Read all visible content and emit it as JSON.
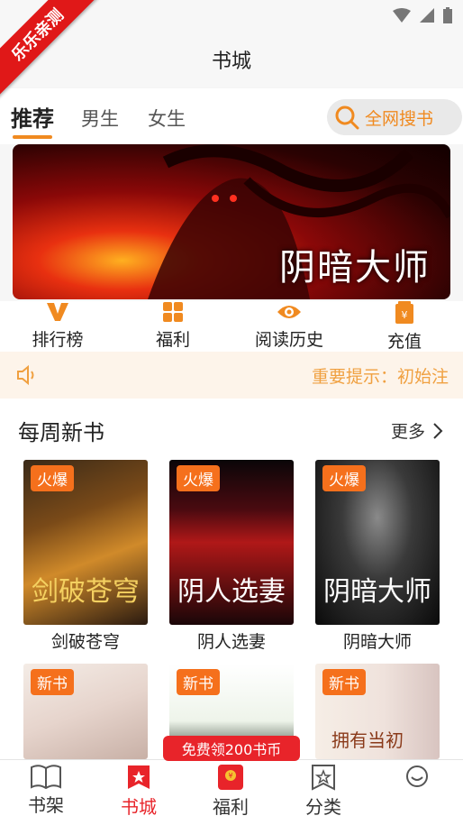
{
  "watermark": "乐乐亲测",
  "header": {
    "title": "书城"
  },
  "tabs": [
    {
      "label": "推荐",
      "active": true
    },
    {
      "label": "男生"
    },
    {
      "label": "女生"
    }
  ],
  "search": {
    "label": "全网搜书",
    "icon": "search-icon"
  },
  "banner": {
    "title": "阴暗大师"
  },
  "quick_links": [
    {
      "label": "排行榜",
      "icon": "v-rank-icon"
    },
    {
      "label": "福利",
      "icon": "grid-icon"
    },
    {
      "label": "阅读历史",
      "icon": "eye-icon"
    },
    {
      "label": "充值",
      "icon": "yen-tag-icon"
    }
  ],
  "notice": {
    "icon": "speaker-icon",
    "text": "重要提示：初始注"
  },
  "weekly": {
    "title": "每周新书",
    "more": "更多",
    "books_row1": [
      {
        "badge": "火爆",
        "name": "剑破苍穹",
        "cover_text": "剑破苍穹"
      },
      {
        "badge": "火爆",
        "name": "阴人选妻",
        "cover_text": "阴人选妻"
      },
      {
        "badge": "火爆",
        "name": "阴暗大师",
        "cover_text": "阴暗大师"
      }
    ],
    "books_row2": [
      {
        "badge": "新书"
      },
      {
        "badge": "新书"
      },
      {
        "badge": "新书",
        "cover_text": "拥有当初"
      }
    ]
  },
  "promo": "免费领200书币",
  "bottom_nav": [
    {
      "label": "书架",
      "icon": "book-open-icon"
    },
    {
      "label": "书城",
      "icon": "store-icon",
      "active": true
    },
    {
      "label": "福利",
      "icon": "red-envelope-icon"
    },
    {
      "label": "分类",
      "icon": "category-icon"
    },
    {
      "label": "",
      "icon": "profile-icon"
    }
  ],
  "colors": {
    "accent": "#f08a20",
    "red": "#e8242a",
    "badge": "#f5701c"
  }
}
